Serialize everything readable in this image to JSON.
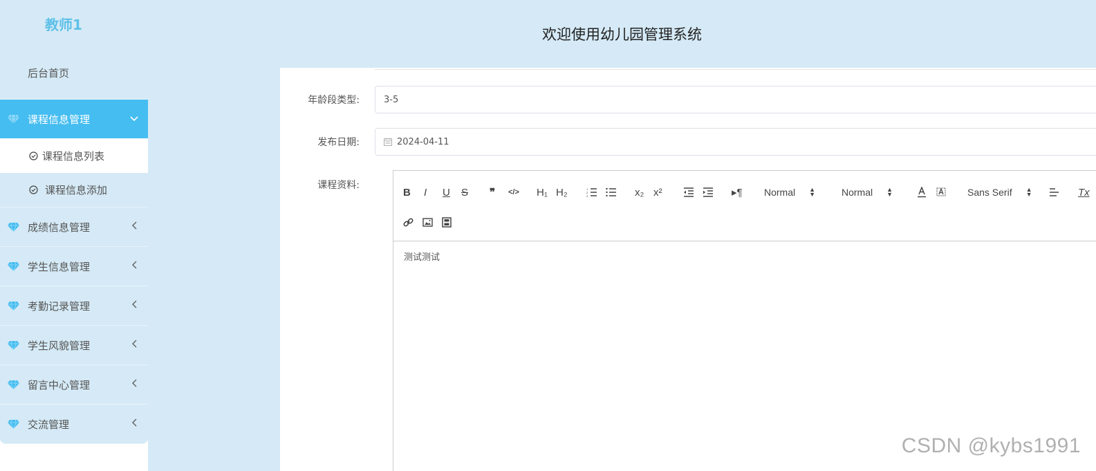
{
  "sidebar": {
    "logo": "教师1",
    "home": "后台首页",
    "active_group": {
      "label": "课程信息管理",
      "arrow": "⌄"
    },
    "sub_items": [
      {
        "label": "课程信息列表"
      },
      {
        "label": "课程信息添加"
      }
    ],
    "groups": [
      {
        "label": "成绩信息管理"
      },
      {
        "label": "学生信息管理"
      },
      {
        "label": "考勤记录管理"
      },
      {
        "label": "学生风貌管理"
      },
      {
        "label": "留言中心管理"
      },
      {
        "label": "交流管理"
      }
    ],
    "accent_color": "#45bdf1"
  },
  "header": {
    "title": "欢迎使用幼儿园管理系统"
  },
  "form": {
    "age_type": {
      "label": "年龄段类型:",
      "value": "3-5"
    },
    "publish_date": {
      "label": "发布日期:",
      "value": "2024-04-11"
    },
    "course_material": {
      "label": "课程资料:",
      "content": "测试测试"
    }
  },
  "toolbar": {
    "bold": "B",
    "italic": "I",
    "underline": "U",
    "strike": "S",
    "quote": "❞",
    "code": "</>",
    "h1": "H₁",
    "h2": "H₂",
    "sub": "x₂",
    "sup": "x²",
    "rtl": "▸¶",
    "size_picker": "Normal",
    "header_picker": "Normal",
    "font_picker": "Sans Serif",
    "clean": "Tx"
  },
  "watermark": "CSDN @kybs1991"
}
